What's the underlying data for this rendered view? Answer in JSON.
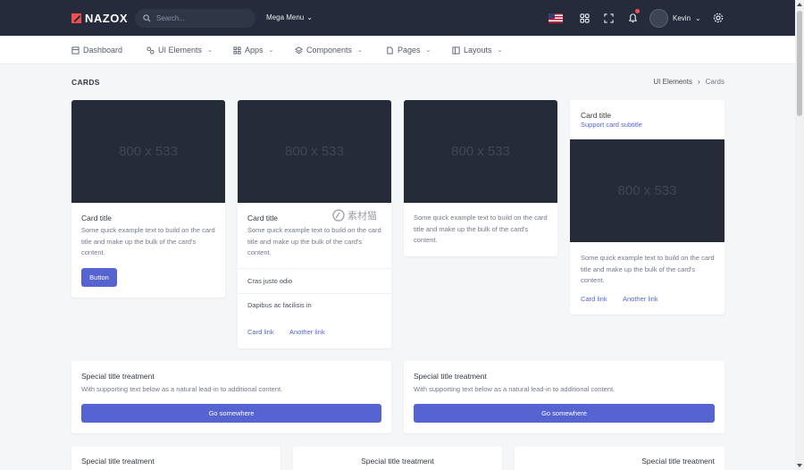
{
  "brand": {
    "name": "NAZOX"
  },
  "search": {
    "placeholder": "Search..."
  },
  "topbar": {
    "mega_menu": "Mega Menu",
    "user_name": "Kevin"
  },
  "nav": {
    "items": [
      {
        "label": "Dashboard",
        "icon": "dashboard-icon"
      },
      {
        "label": "UI Elements",
        "icon": "ui-elements-icon"
      },
      {
        "label": "Apps",
        "icon": "apps-icon"
      },
      {
        "label": "Components",
        "icon": "components-icon"
      },
      {
        "label": "Pages",
        "icon": "pages-icon"
      },
      {
        "label": "Layouts",
        "icon": "layouts-icon"
      }
    ]
  },
  "page": {
    "title": "CARDS",
    "breadcrumb": [
      "UI Elements",
      "Cards"
    ]
  },
  "cards": {
    "placeholder": "800 x 533",
    "card1": {
      "title": "Card title",
      "text": "Some quick example text to build on the card title and make up the bulk of the card's content.",
      "button": "Button"
    },
    "card2": {
      "title": "Card title",
      "text": "Some quick example text to build on the card title and make up the bulk of the card's content.",
      "list": [
        "Cras justo odio",
        "Dapibus ac facilisis in"
      ],
      "link1": "Card link",
      "link2": "Another link"
    },
    "card3": {
      "text": "Some quick example text to build on the card title and make up the bulk of the card's content."
    },
    "card4": {
      "title": "Card title",
      "subtitle": "Support card subtitle",
      "text": "Some quick example text to build on the card title and make up the bulk of the card's content.",
      "link1": "Card link",
      "link2": "Another link"
    }
  },
  "special": {
    "title": "Special title treatment",
    "text": "With supporting text below as a natural lead-in to additional content.",
    "button": "Go somewhere"
  },
  "watermark": "素材猫",
  "colors": {
    "topbar": "#252b3b",
    "primary": "#5664d2",
    "danger": "#f34e4e"
  }
}
